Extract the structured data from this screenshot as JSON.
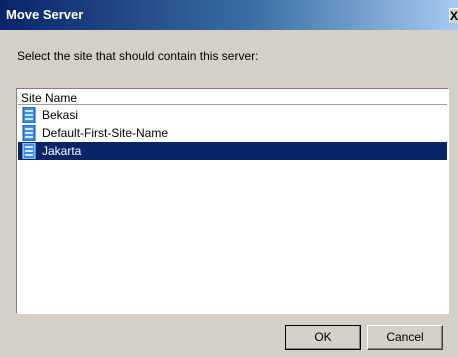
{
  "window": {
    "title": "Move Server",
    "close_label": "X"
  },
  "prompt": "Select the site that should contain this server:",
  "list": {
    "column_header": "Site Name",
    "items": [
      {
        "label": "Bekasi",
        "icon": "server-icon",
        "selected": false
      },
      {
        "label": "Default-First-Site-Name",
        "icon": "server-icon",
        "selected": false
      },
      {
        "label": "Jakarta",
        "icon": "server-icon",
        "selected": true
      }
    ]
  },
  "buttons": {
    "ok": "OK",
    "cancel": "Cancel"
  },
  "colors": {
    "title_bar": "#0a246a",
    "selection": "#0a246a",
    "dialog_bg": "#d4d0c8"
  }
}
